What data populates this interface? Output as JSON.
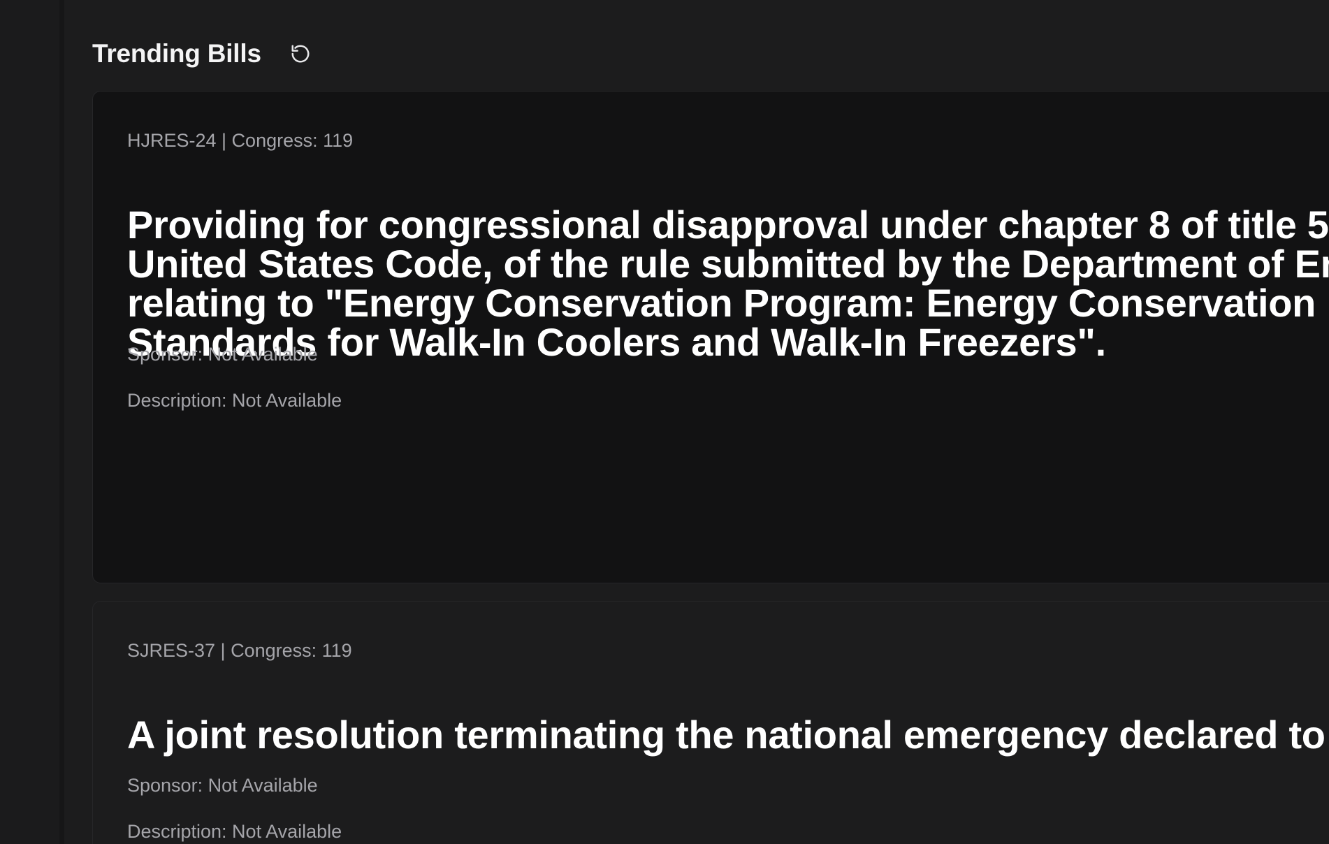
{
  "header": {
    "title": "Trending Bills",
    "refresh_icon": "refresh-icon"
  },
  "bills": [
    {
      "meta": "HJRES-24 | Congress: 119",
      "title": "Providing for congressional disapproval under chapter 8 of title 5, United States Code, of the rule submitted by the Department of Energy relating to \"Energy Conservation Program: Energy Conservation Standards for Walk-In Coolers and Walk-In Freezers\".",
      "sponsor": "Sponsor: Not Available",
      "description": "Description: Not Available"
    },
    {
      "meta": "SJRES-37 | Congress: 119",
      "title": "A joint resolution terminating the national emergency declared to impose duties on articles imported from Canada.",
      "sponsor": "Sponsor: Not Available",
      "description": "Description: Not Available"
    }
  ],
  "colors": {
    "background": "#1c1c1d",
    "card_active": "#121213",
    "text_primary": "#ffffff",
    "text_secondary": "#a5a5aa"
  }
}
